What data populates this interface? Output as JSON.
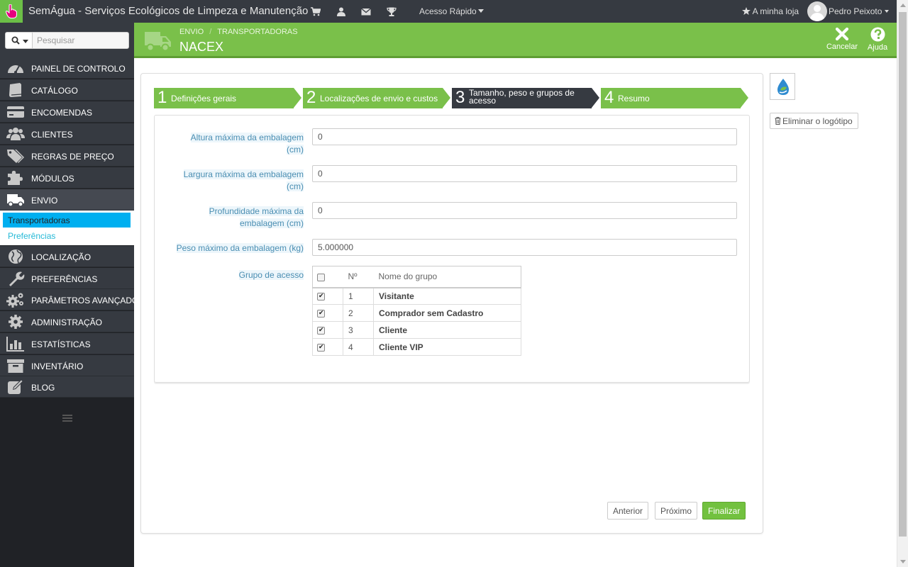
{
  "topbar": {
    "shop_name": "SemÁgua - Serviços Ecológicos de Limpeza e Manutenção",
    "quick_access": "Acesso Rápido",
    "my_shop": "A minha loja",
    "user_name": "Pedro Peixoto",
    "icons": [
      "cart-icon",
      "user-icon",
      "envelope-icon",
      "trophy-icon"
    ]
  },
  "sidebar": {
    "search_placeholder": "Pesquisar",
    "items": [
      {
        "label": "PAINEL DE CONTROLO",
        "icon": "dashboard-icon"
      },
      {
        "label": "CATÁLOGO",
        "icon": "book-icon"
      },
      {
        "label": "ENCOMENDAS",
        "icon": "credit-card-icon"
      },
      {
        "label": "CLIENTES",
        "icon": "users-icon"
      },
      {
        "label": "REGRAS DE PREÇO",
        "icon": "tags-icon"
      },
      {
        "label": "MÓDULOS",
        "icon": "puzzle-icon"
      },
      {
        "label": "ENVIO",
        "icon": "truck-icon"
      },
      {
        "label": "LOCALIZAÇÃO",
        "icon": "globe-icon"
      },
      {
        "label": "PREFERÊNCIAS",
        "icon": "wrench-icon"
      },
      {
        "label": "PARÂMETROS AVANÇADOS",
        "icon": "cogs-icon"
      },
      {
        "label": "ADMINISTRAÇÃO",
        "icon": "cog-icon"
      },
      {
        "label": "ESTATÍSTICAS",
        "icon": "bar-chart-icon"
      },
      {
        "label": "INVENTÁRIO",
        "icon": "archive-icon"
      },
      {
        "label": "BLOG",
        "icon": "edit-icon"
      }
    ],
    "submenu": [
      {
        "label": "Transportadoras"
      },
      {
        "label": "Preferências"
      }
    ]
  },
  "header": {
    "breadcrumb": [
      "ENVIO",
      "TRANSPORTADORAS"
    ],
    "title": "NACEX",
    "cancel_label": "Cancelar",
    "help_label": "Ajuda"
  },
  "wizard": {
    "steps": [
      {
        "number": "1",
        "label": "Definições gerais"
      },
      {
        "number": "2",
        "label": "Localizações de envio e custos"
      },
      {
        "number": "3",
        "label": "Tamanho, peso e grupos de acesso"
      },
      {
        "number": "4",
        "label": "Resumo"
      }
    ],
    "current_step": 3
  },
  "form": {
    "max_height": {
      "label": "Altura máxima da embalagem (cm)",
      "value": "0"
    },
    "max_width": {
      "label": "Largura máxima da embalagem (cm)",
      "value": "0"
    },
    "max_depth": {
      "label": "Profundidade máxima da embalagem (cm)",
      "value": "0"
    },
    "max_weight": {
      "label": "Peso máximo da embalagem (kg)",
      "value": "5.000000"
    },
    "access_group": {
      "label": "Grupo de acesso",
      "columns": [
        "Nº",
        "Nome do grupo"
      ],
      "rows": [
        {
          "id": "1",
          "name": "Visitante",
          "checked": true
        },
        {
          "id": "2",
          "name": "Comprador sem Cadastro",
          "checked": true
        },
        {
          "id": "3",
          "name": "Cliente",
          "checked": true
        },
        {
          "id": "4",
          "name": "Cliente VIP",
          "checked": true
        }
      ]
    }
  },
  "footer": {
    "previous": "Anterior",
    "next": "Próximo",
    "finish": "Finalizar"
  },
  "logo_panel": {
    "delete_label": "Eliminar o logótipo"
  },
  "colors": {
    "accent_green": "#7ac04a",
    "dark": "#363a41",
    "active_blue": "#00aff0"
  }
}
